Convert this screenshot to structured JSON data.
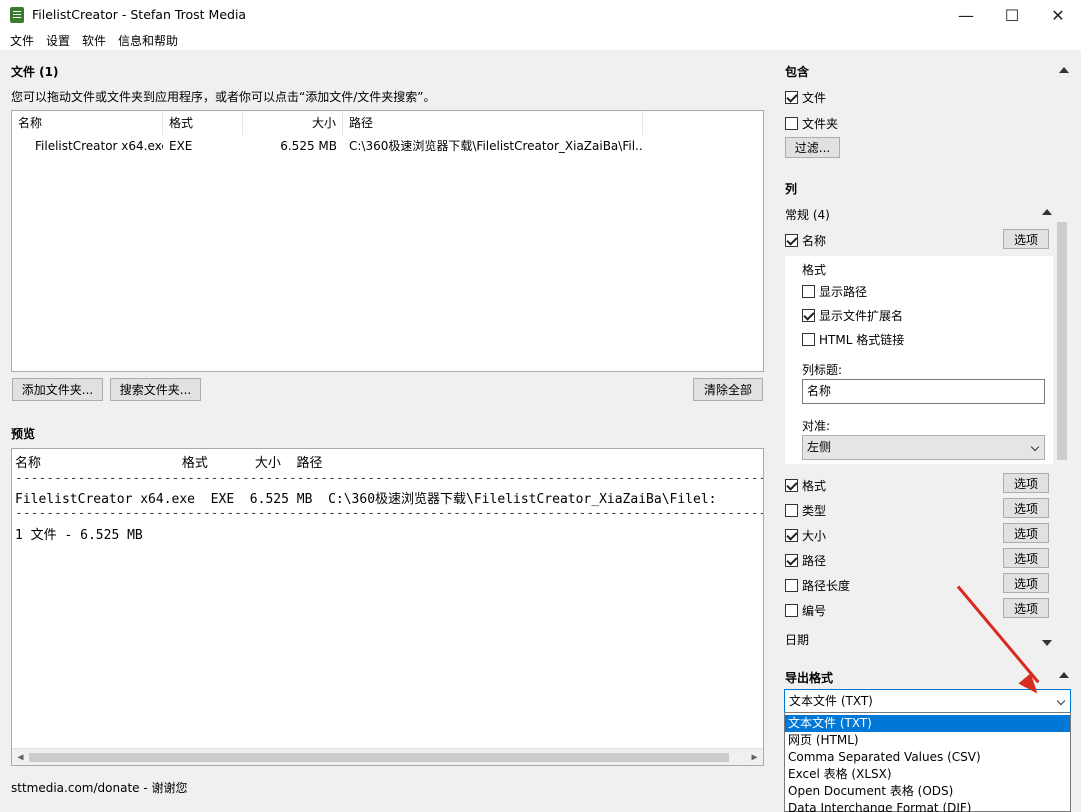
{
  "window": {
    "title": "FilelistCreator - Stefan Trost Media",
    "minimize": "—",
    "maximize": "☐",
    "close": "✕"
  },
  "menu": [
    "文件",
    "设置",
    "软件",
    "信息和帮助"
  ],
  "files": {
    "title": "文件 (1)",
    "hint": "您可以拖动文件或文件夹到应用程序，或者你可以点击“添加文件/文件夹搜索”。",
    "columns": [
      "名称",
      "格式",
      "大小",
      "路径"
    ],
    "rows": [
      {
        "name": "FilelistCreator x64.exe",
        "format": "EXE",
        "size": "6.525 MB",
        "path": "C:\\360极速浏览器下载\\FilelistCreator_XiaZaiBa\\Fil..."
      }
    ],
    "add_folder": "添加文件夹...",
    "search_folder": "搜索文件夹...",
    "clear_all": "清除全部"
  },
  "preview": {
    "title": "预览",
    "header": "名称                  格式      大小  路径",
    "separator": "-------------------------------------------------------------------------------------------------",
    "row": "FilelistCreator x64.exe  EXE  6.525 MB  C:\\360极速浏览器下载\\FilelistCreator_XiaZaiBa\\Filel:",
    "summary": "1 文件 - 6.525 MB"
  },
  "footer": "sttmedia.com/donate - 谢谢您",
  "include": {
    "title": "包含",
    "files_label": "文件",
    "files_checked": true,
    "folders_label": "文件夹",
    "folders_checked": false,
    "filter": "过滤..."
  },
  "columns_panel": {
    "title": "列",
    "group": "常规 (4)",
    "name_label": "名称",
    "options": "选项",
    "format_heading": "格式",
    "show_path": "显示路径",
    "show_ext": "显示文件扩展名",
    "html_link": "HTML 格式链接",
    "col_title_label": "列标题:",
    "col_title_value": "名称",
    "align_label": "对准:",
    "align_value": "左侧",
    "items": [
      {
        "label": "格式",
        "checked": true
      },
      {
        "label": "类型",
        "checked": false
      },
      {
        "label": "大小",
        "checked": true
      },
      {
        "label": "路径",
        "checked": true
      },
      {
        "label": "路径长度",
        "checked": false
      },
      {
        "label": "编号",
        "checked": false
      }
    ],
    "next_group": "日期"
  },
  "export": {
    "title": "导出格式",
    "selected": "文本文件 (TXT)",
    "options": [
      "文本文件 (TXT)",
      "网页 (HTML)",
      "Comma Separated Values (CSV)",
      "Excel 表格 (XLSX)",
      "Open Document 表格 (ODS)",
      "Data Interchange Format (DIF)"
    ]
  }
}
